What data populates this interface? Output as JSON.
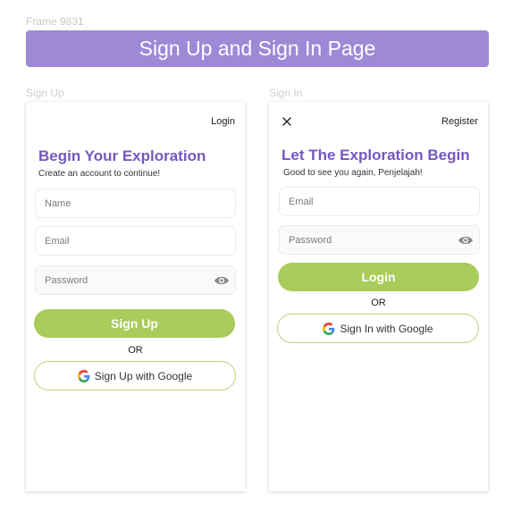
{
  "frame_label": "Frame 9831",
  "banner_title": "Sign Up and Sign In Page",
  "signup": {
    "section_label": "Sign Up",
    "top_link": "Login",
    "heading": "Begin Your Exploration",
    "subtext": "Create an account to continue!",
    "name_placeholder": "Name",
    "email_placeholder": "Email",
    "password_placeholder": "Password",
    "primary_button": "Sign Up",
    "or_text": "OR",
    "google_button": "Sign Up with Google"
  },
  "signin": {
    "section_label": "Sign In",
    "top_link": "Register",
    "heading": "Let The Exploration Begin",
    "subtext": "Good to see you again, Penjelajah!",
    "email_placeholder": "Email",
    "password_placeholder": "Password",
    "primary_button": "Login",
    "or_text": "OR",
    "google_button": "Sign In with Google"
  },
  "colors": {
    "banner": "#9e89d6",
    "heading": "#7656c0",
    "primary_button": "#a9cc5a",
    "google_border": "#b8d27a"
  },
  "icons": {
    "close": "close-icon",
    "eye": "eye-icon",
    "google": "google-icon"
  }
}
